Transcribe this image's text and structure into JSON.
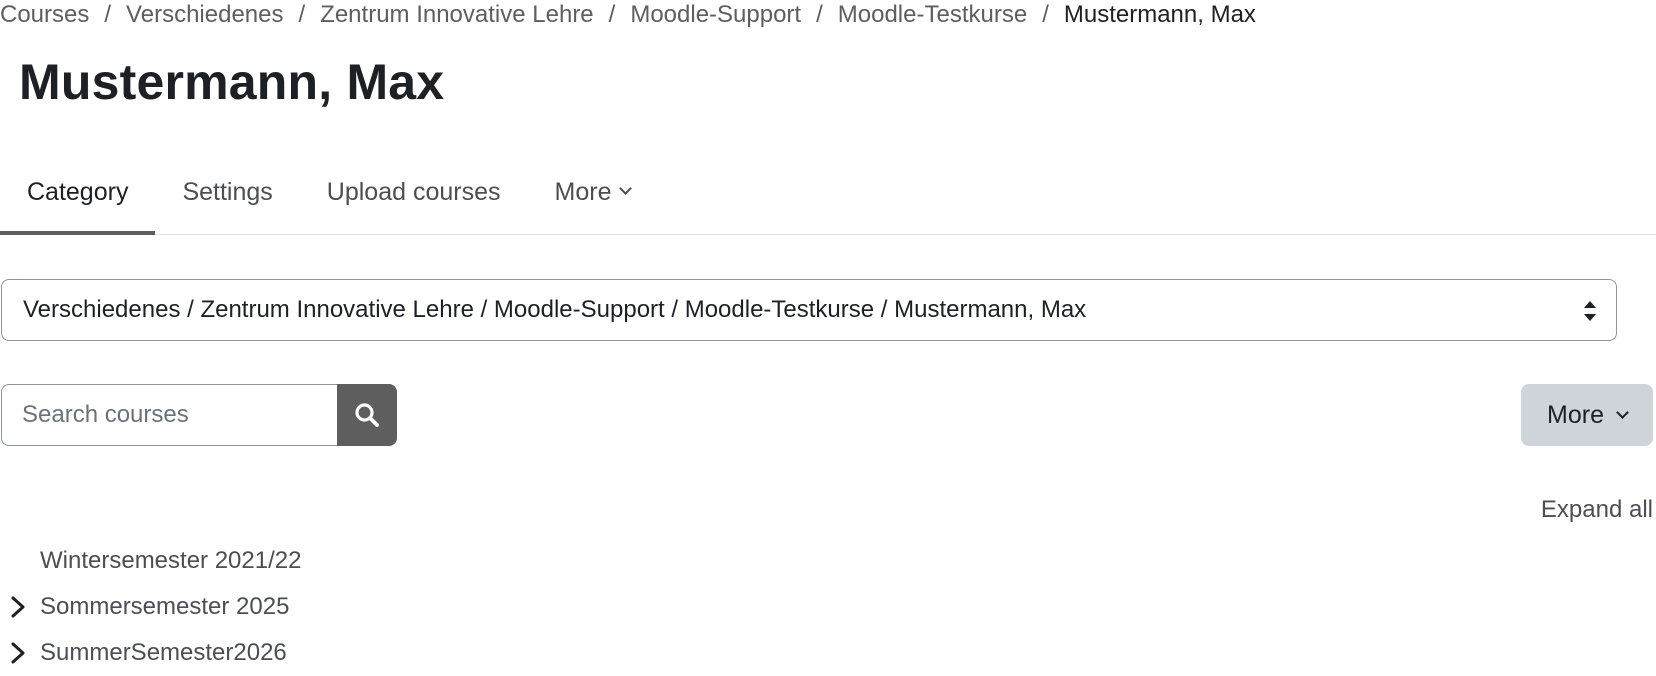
{
  "breadcrumb": {
    "items": [
      {
        "label": "Courses"
      },
      {
        "label": "Verschiedenes"
      },
      {
        "label": "Zentrum Innovative Lehre"
      },
      {
        "label": "Moodle-Support"
      },
      {
        "label": "Moodle-Testkurse"
      },
      {
        "label": "Mustermann, Max"
      }
    ],
    "separator": "/"
  },
  "page": {
    "title": "Mustermann, Max"
  },
  "tabs": [
    {
      "label": "Category",
      "active": true
    },
    {
      "label": "Settings",
      "active": false
    },
    {
      "label": "Upload courses",
      "active": false
    },
    {
      "label": "More",
      "active": false
    }
  ],
  "category_select": {
    "value": "Verschiedenes / Zentrum Innovative Lehre / Moodle-Support / Moodle-Testkurse / Mustermann, Max"
  },
  "search": {
    "placeholder": "Search courses",
    "value": "",
    "button_icon": "search-icon"
  },
  "actions": {
    "more_label": "More"
  },
  "tree": {
    "expand_all_label": "Expand all",
    "categories": [
      {
        "name": "Wintersemester 2021/22",
        "has_children": false
      },
      {
        "name": "Sommersemester 2025",
        "has_children": true
      },
      {
        "name": "SummerSemester2026",
        "has_children": true
      }
    ]
  },
  "colors": {
    "text": "#1d2125",
    "muted_text": "#4a4f55",
    "search_button_bg": "#5e5e5e",
    "more_button_bg": "#ced4da",
    "border": "#8f959e",
    "tab_underline": "#5e5e5e"
  }
}
